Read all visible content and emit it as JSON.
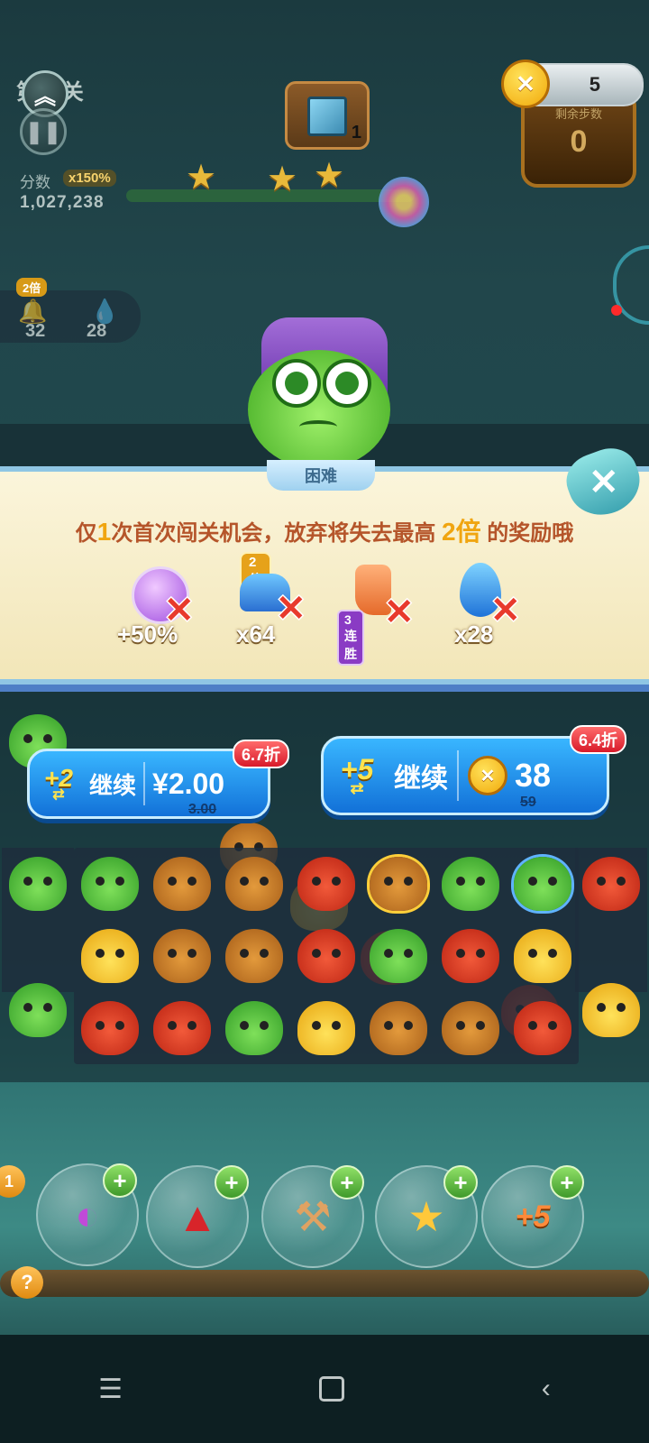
{
  "hud": {
    "level_text": "第29关",
    "score_label": "分数",
    "score_multiplier": "x150%",
    "score_value": "1,027,238",
    "goal_count": "1",
    "coins": "5",
    "steps_label": "剩余步数",
    "steps_value": "0",
    "buff_badge": "2倍",
    "buff_count_1": "32",
    "buff_count_2": "28",
    "stars_earned": 3
  },
  "dialog": {
    "difficulty_tab": "困难",
    "message_prefix": "仅",
    "message_count": "1",
    "message_middle": "次首次闯关机会，放弃将失去最高",
    "message_multiplier": "2倍",
    "message_suffix": "的奖励哦",
    "rewards": [
      {
        "label": "+50%",
        "icon": "potion-icon"
      },
      {
        "label": "x64",
        "badge": "2倍",
        "icon": "bell-icon"
      },
      {
        "label": "3连胜",
        "icon": "boot-icon"
      },
      {
        "label": "x28",
        "icon": "water-drop-icon"
      }
    ],
    "continue_pay": {
      "plus": "+2",
      "label": "继续",
      "price": "¥2.00",
      "original": "3.00",
      "discount": "6.7折"
    },
    "continue_coins": {
      "plus": "+5",
      "label": "继续",
      "price": "38",
      "original": "59",
      "discount": "6.4折"
    }
  },
  "boosters": [
    {
      "icon": "swap-fish-icon"
    },
    {
      "icon": "rocket-icon"
    },
    {
      "icon": "hammer-icon"
    },
    {
      "icon": "magic-star-icon"
    },
    {
      "icon": "plus-five-icon",
      "label": "+5"
    }
  ],
  "booster_count": "1",
  "help_label": "?",
  "colors": {
    "accent_blue": "#1e90ff",
    "discount_red": "#e8262f",
    "reward_orange": "#f0a510"
  }
}
